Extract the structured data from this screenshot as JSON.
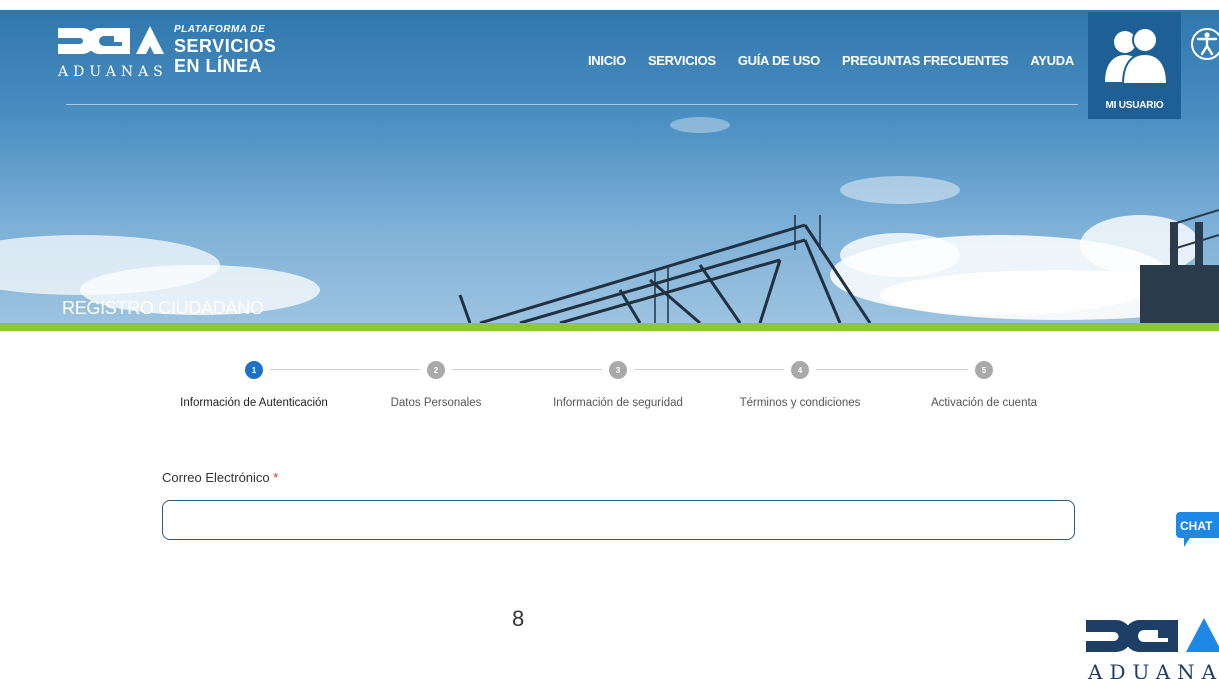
{
  "header": {
    "logo": {
      "brand": "DGA",
      "aduanas": "ADUANAS",
      "plataforma": "PLATAFORMA DE",
      "servicios": "SERVICIOS",
      "en_linea": "EN LÍNEA"
    },
    "nav": [
      {
        "label": "INICIO"
      },
      {
        "label": "SERVICIOS"
      },
      {
        "label": "GUÍA DE USO"
      },
      {
        "label": "PREGUNTAS FRECUENTES"
      },
      {
        "label": "AYUDA"
      }
    ],
    "user_label": "MI USUARIO",
    "icons": {
      "user": "user-group-icon",
      "accessibility": "accessibility-icon"
    }
  },
  "page_title": "REGISTRO CIUDADANO",
  "stepper": {
    "steps": [
      {
        "number": "1",
        "label": "Información de Autenticación",
        "active": true
      },
      {
        "number": "2",
        "label": "Datos Personales",
        "active": false
      },
      {
        "number": "3",
        "label": "Información de seguridad",
        "active": false
      },
      {
        "number": "4",
        "label": "Términos y condiciones",
        "active": false
      },
      {
        "number": "5",
        "label": "Activación de cuenta",
        "active": false
      }
    ]
  },
  "form": {
    "email_label": "Correo Electrónico",
    "required_mark": "*",
    "email_value": ""
  },
  "chat": {
    "label": "CHAT",
    "icon": "chat-bubble-icon"
  },
  "page_number": "8",
  "footer_logo": {
    "aduanas": "ADUANAS"
  },
  "colors": {
    "accent_blue": "#1a73c7",
    "header_blue": "#1e5f95",
    "green_bar": "#8cc63f",
    "required_red": "#e03030",
    "chat_blue": "#1e88e5",
    "footer_navy": "#1d3f66"
  }
}
